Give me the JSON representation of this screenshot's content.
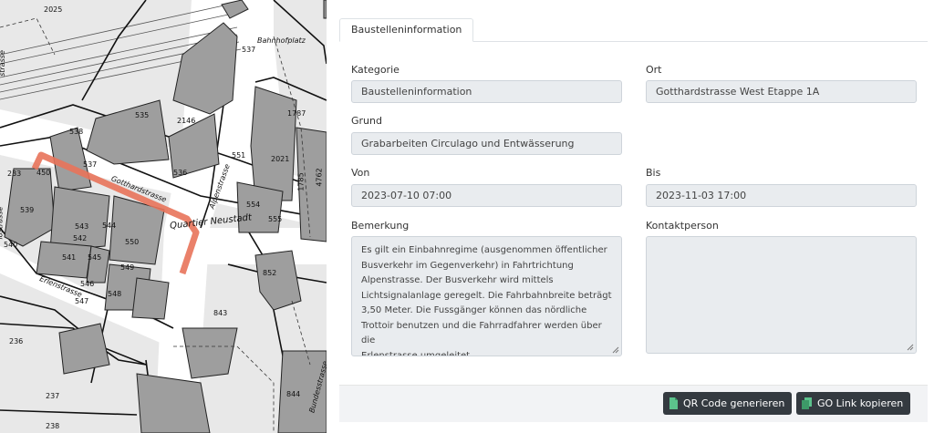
{
  "map": {
    "labels": {
      "l2025": "2025",
      "l537a": "537",
      "bahnhofplatz": "Bahnhofplatz",
      "l535": "535",
      "l2146": "2146",
      "l1787": "1787",
      "l538": "538",
      "l537b": "537",
      "l536": "536",
      "l551": "551",
      "l2021": "2021",
      "l4762": "4762",
      "l1785": "1785",
      "l450": "450",
      "l539": "539",
      "gotthardstrasse": "Gotthardstrasse",
      "alpenstrasse": "Alpenstrasse",
      "l554": "554",
      "l555": "555",
      "quartier": "Quartier Neustadt",
      "l543": "543",
      "l544": "544",
      "l542": "542",
      "l550": "550",
      "l541": "541",
      "l545": "545",
      "l540": "540",
      "l549": "549",
      "l546": "546",
      "l548": "548",
      "erlenstrasse": "Erlenstrasse",
      "l547": "547",
      "l852": "852",
      "l843": "843",
      "l236": "236",
      "l237": "237",
      "l238": "238",
      "l844": "844",
      "bundesstrasse": "Bundesstrasse",
      "l233": "233",
      "lostrasse": "lostrasse",
      "strasse": "strasse"
    }
  },
  "tabs": [
    {
      "label": "Baustelleninformation"
    }
  ],
  "form": {
    "kategorie": {
      "label": "Kategorie",
      "value": "Baustelleninformation"
    },
    "ort": {
      "label": "Ort",
      "value": "Gotthardstrasse West Etappe 1A"
    },
    "grund": {
      "label": "Grund",
      "value": "Grabarbeiten Circulago und Entwässerung"
    },
    "von": {
      "label": "Von",
      "value": "2023-07-10 07:00"
    },
    "bis": {
      "label": "Bis",
      "value": "2023-11-03 17:00"
    },
    "bemerkung": {
      "label": "Bemerkung",
      "lines": [
        "Es gilt ein Einbahnregime (ausgenommen öffentlicher",
        "Busverkehr im Gegenverkehr) in Fahrtrichtung",
        "Alpenstrasse. Der Busverkehr wird mittels",
        "Lichtsignalanlage geregelt. Die Fahrbahnbreite beträgt",
        "3,50 Meter. Die Fussgänger können das nördliche",
        "Trottoir benutzen und die Fahrradfahrer werden über die",
        "Erlenstrasse umgeleitet."
      ]
    },
    "kontaktperson": {
      "label": "Kontaktperson",
      "value": ""
    }
  },
  "buttons": {
    "qr": {
      "label": "QR Code generieren",
      "icon": "file-icon"
    },
    "go": {
      "label": "GO Link kopieren",
      "icon": "copy-icon"
    }
  },
  "colors": {
    "button_bg": "#343a40",
    "field_bg": "#e9ecef",
    "highlight": "#e8735a"
  }
}
